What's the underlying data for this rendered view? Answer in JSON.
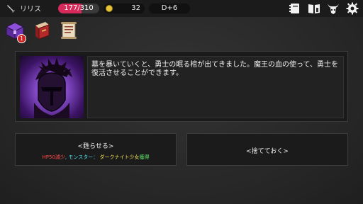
{
  "player": {
    "name": "リリス",
    "icon": "dagger-icon"
  },
  "stats": {
    "hp_current": 177,
    "hp_max": 310,
    "hp_text": "177/310",
    "gold": "32",
    "day": "D+6"
  },
  "top_menu": {
    "icons": [
      "notebook-icon",
      "book-icon",
      "demon-horns-icon",
      "gear-icon"
    ]
  },
  "inventory": {
    "items": [
      {
        "icon": "purple-chest-icon",
        "badge": "1"
      },
      {
        "icon": "red-book-icon"
      },
      {
        "icon": "scroll-icon"
      }
    ]
  },
  "event": {
    "image": "dark-knight-helmet-icon",
    "text": "墓を暴いていくと、勇士の眠る棺が出てきました。魔王の血の使って、勇士を復活させることができます。"
  },
  "choices": {
    "revive": {
      "title": "<甦らせる>",
      "effect_hp": "HP50減少",
      "effect_sep": ", ",
      "effect_monster_label": "モンスター：",
      "effect_monster_name": " ダークナイト少女",
      "effect_gain": "獲得"
    },
    "discard": {
      "title": "<捨てておく>"
    }
  },
  "colors": {
    "hp_bar": "#d62a5a",
    "effect_red": "#ff4a4a",
    "effect_cyan": "#4fd8e8",
    "effect_yellow": "#f2e25a",
    "effect_green": "#5ee66a"
  }
}
